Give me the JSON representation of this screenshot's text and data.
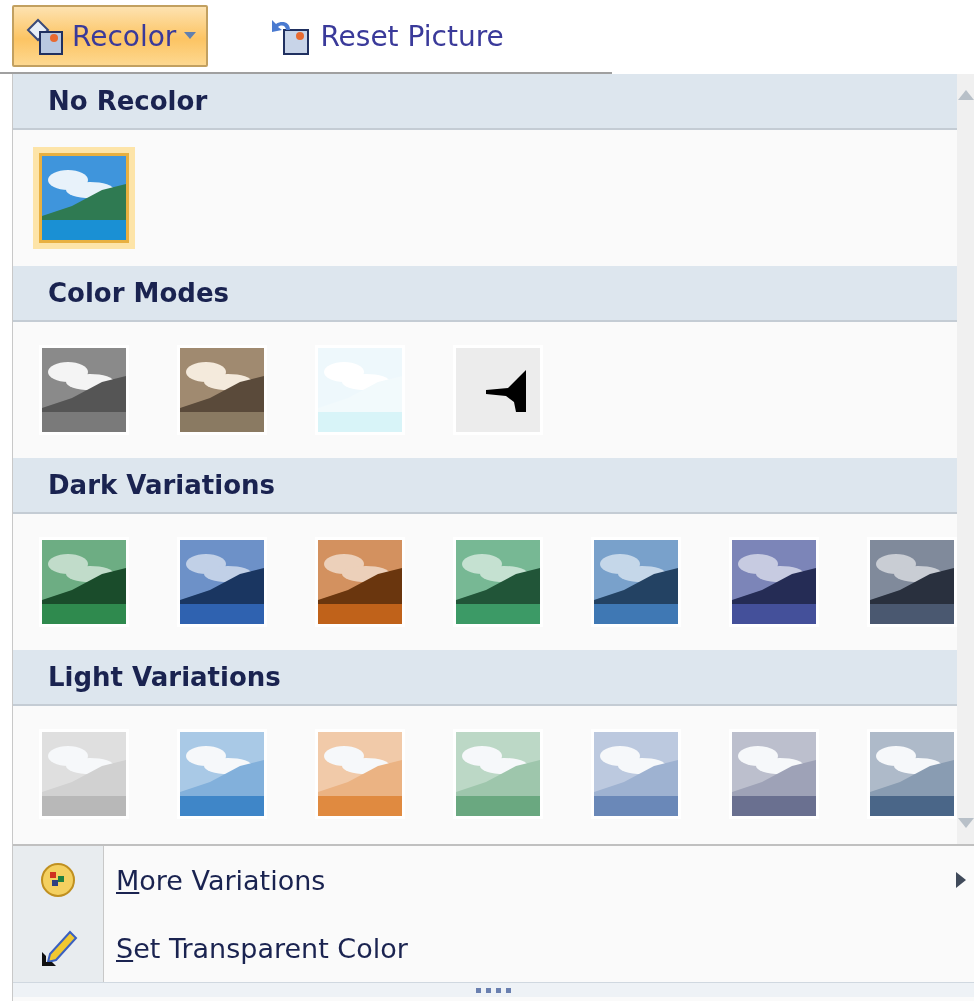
{
  "toolbar": [
    {
      "label": "Recolor",
      "kind": "dropdown",
      "selected": true
    },
    {
      "label": "Reset Picture",
      "kind": "button",
      "selected": false
    }
  ],
  "sections": [
    {
      "title": "No Recolor",
      "options": [
        {
          "kind": "original",
          "selected": true
        }
      ]
    },
    {
      "title": "Color Modes",
      "options": [
        {
          "kind": "grayscale",
          "selected": false
        },
        {
          "kind": "sepia",
          "selected": false
        },
        {
          "kind": "washout",
          "selected": false
        },
        {
          "kind": "blackwhite",
          "selected": false
        }
      ]
    },
    {
      "title": "Dark Variations",
      "options": [
        {
          "kind": "dark",
          "color": "#2f8a4e",
          "selected": false
        },
        {
          "kind": "dark",
          "color": "#2f62b0",
          "selected": false
        },
        {
          "kind": "dark",
          "color": "#c0621a",
          "selected": false
        },
        {
          "kind": "dark",
          "color": "#3c9a66",
          "selected": false
        },
        {
          "kind": "dark",
          "color": "#3f78b4",
          "selected": false
        },
        {
          "kind": "dark",
          "color": "#44509a",
          "selected": false
        },
        {
          "kind": "dark",
          "color": "#4a5870",
          "selected": false
        }
      ]
    },
    {
      "title": "Light Variations",
      "options": [
        {
          "kind": "light",
          "color": "#b8b8b8",
          "selected": false
        },
        {
          "kind": "light",
          "color": "#3f86c8",
          "selected": false
        },
        {
          "kind": "light",
          "color": "#e08a40",
          "selected": false
        },
        {
          "kind": "light",
          "color": "#6aa880",
          "selected": false
        },
        {
          "kind": "light",
          "color": "#6a88b8",
          "selected": false
        },
        {
          "kind": "light",
          "color": "#6a7090",
          "selected": false
        },
        {
          "kind": "light",
          "color": "#4a6688",
          "selected": false
        }
      ]
    }
  ],
  "menu_items": [
    {
      "label": "More Variations",
      "kind": "palette",
      "has_submenu": true
    },
    {
      "label": "Set Transparent Color",
      "kind": "pen",
      "has_submenu": false
    }
  ]
}
